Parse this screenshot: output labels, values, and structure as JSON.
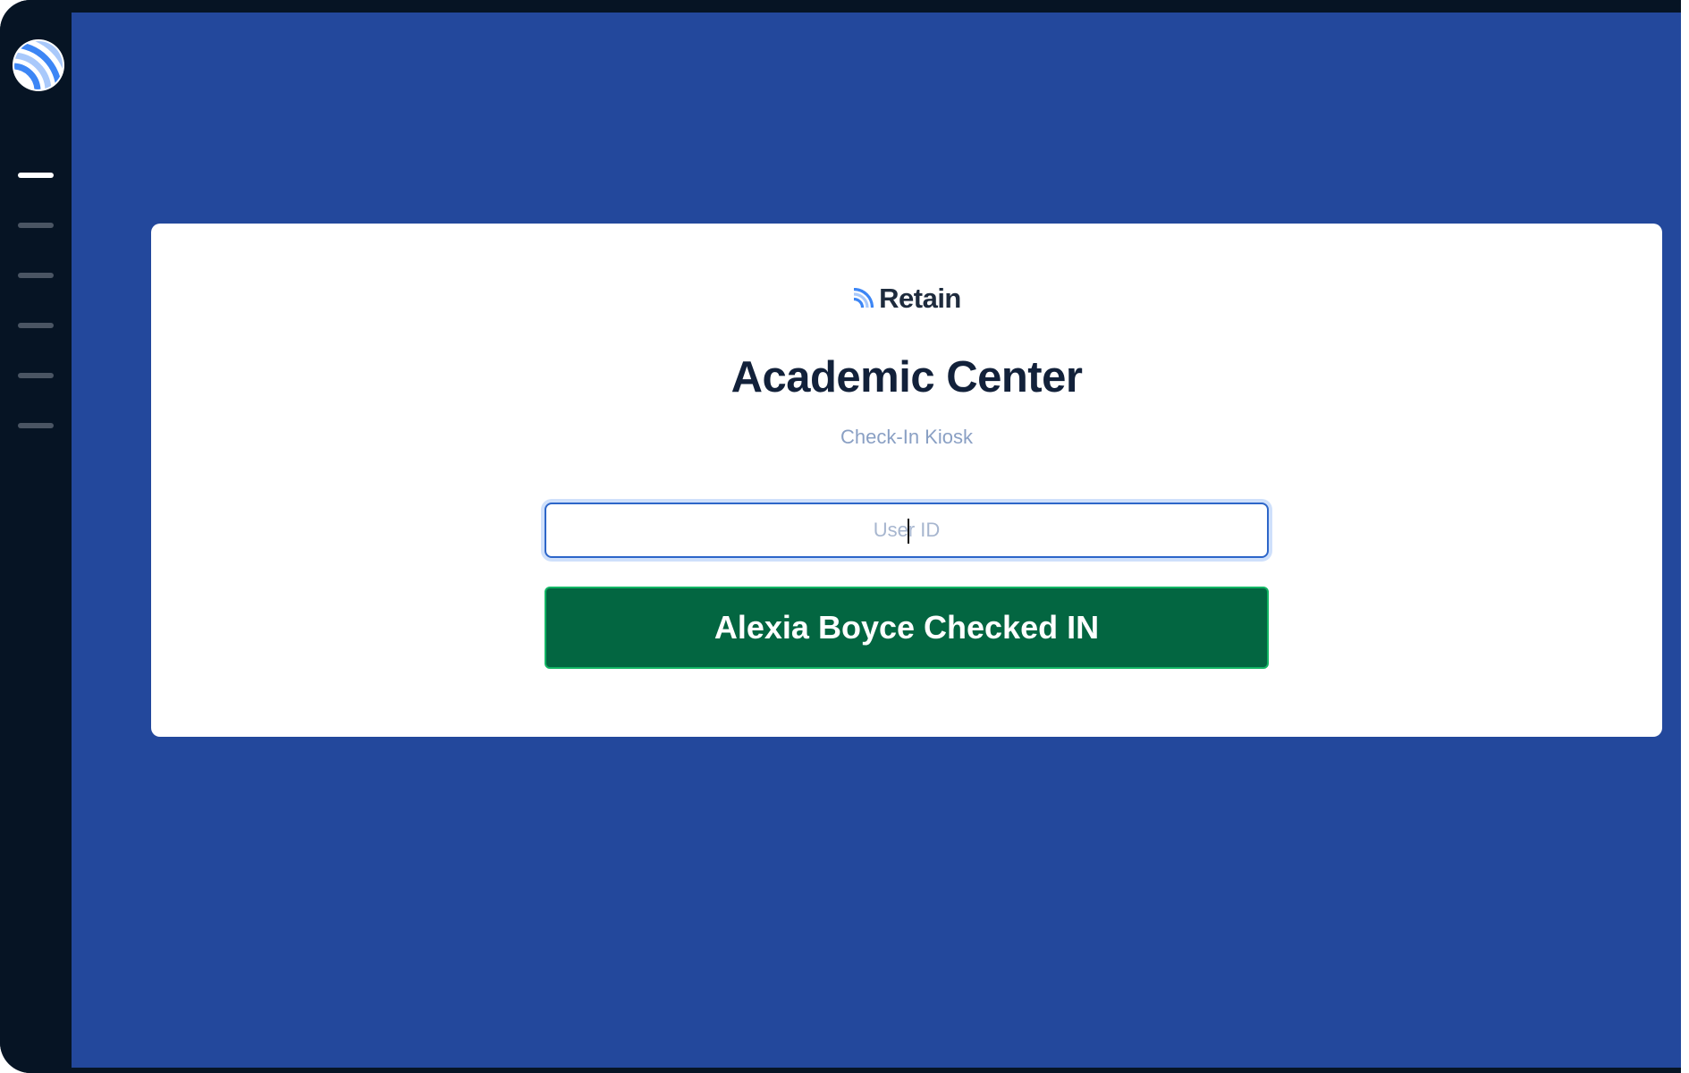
{
  "app": {
    "logo_icon": "retain-wave-logo-icon"
  },
  "sidebar": {
    "items": [
      {
        "name": "nav-item-1",
        "active": true
      },
      {
        "name": "nav-item-2",
        "active": false
      },
      {
        "name": "nav-item-3",
        "active": false
      },
      {
        "name": "nav-item-4",
        "active": false
      },
      {
        "name": "nav-item-5",
        "active": false
      },
      {
        "name": "nav-item-6",
        "active": false
      }
    ]
  },
  "card": {
    "brand_name": "Retain",
    "brand_icon": "retain-wave-icon",
    "title": "Academic Center",
    "subtitle": "Check-In Kiosk",
    "user_id_input": {
      "value": "",
      "placeholder": "User ID"
    },
    "status_button_label": "Alexia Boyce Checked IN"
  },
  "colors": {
    "sidebar_bg": "#061424",
    "main_bg": "#23489c",
    "card_bg": "#ffffff",
    "title_color": "#12213a",
    "subtitle_color": "#8aa0c4",
    "input_border": "#2d66c9",
    "status_bg": "#036641",
    "status_border": "#12b564",
    "logo_blue": "#3d86f5",
    "logo_light": "#a9c9fb"
  }
}
